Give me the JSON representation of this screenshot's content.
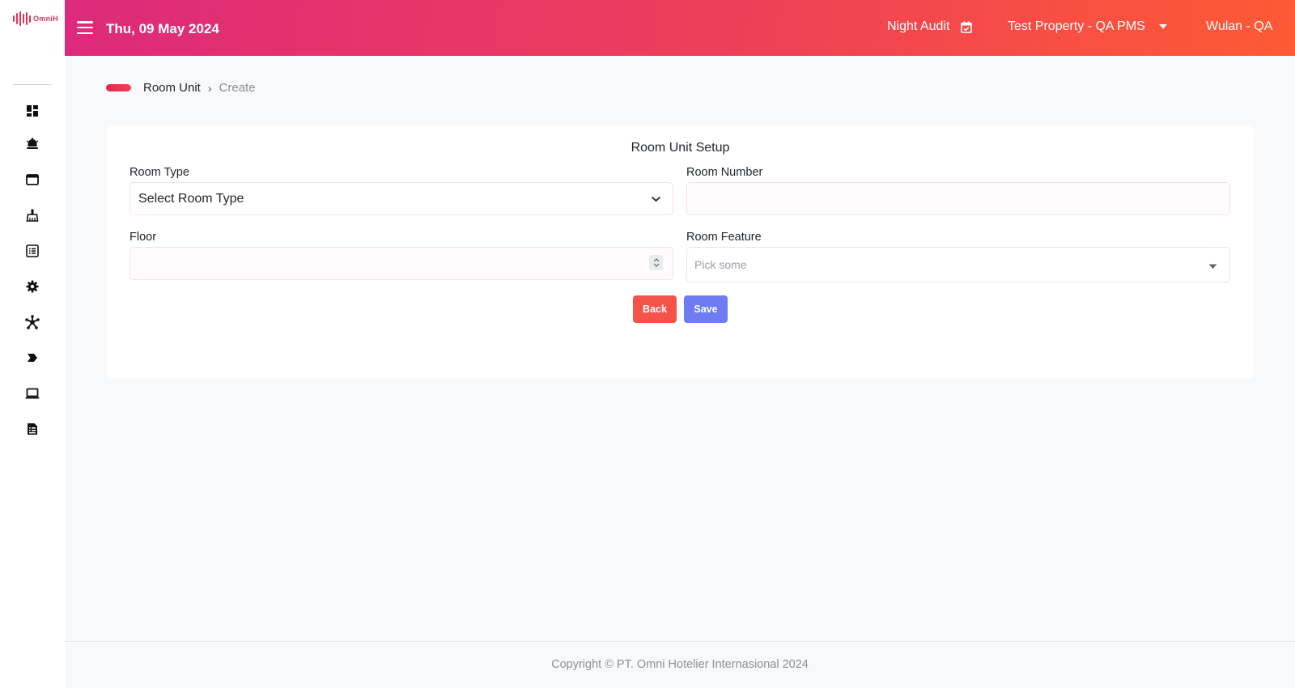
{
  "app": {
    "logo_text": "OmniH"
  },
  "header": {
    "date": "Thu, 09 May 2024",
    "night_audit_label": "Night Audit",
    "property_label": "Test Property - QA PMS",
    "user_label": "Wulan - QA",
    "background_gradient": [
      "#dd2a7b",
      "#ef3f58",
      "#fe5a34"
    ]
  },
  "sidebar": {
    "items": [
      {
        "icon": "dashboard-icon"
      },
      {
        "icon": "concierge-bell-icon"
      },
      {
        "icon": "window-icon"
      },
      {
        "icon": "broom-icon"
      },
      {
        "icon": "list-icon"
      },
      {
        "icon": "gear-icon"
      },
      {
        "icon": "network-icon"
      },
      {
        "icon": "chevron-tag-icon"
      },
      {
        "icon": "laptop-icon"
      },
      {
        "icon": "report-icon"
      }
    ]
  },
  "breadcrumb": {
    "parent": "Room Unit",
    "separator": "›",
    "current": "Create"
  },
  "form": {
    "title": "Room Unit Setup",
    "room_type": {
      "label": "Room Type",
      "value": "Select Room Type"
    },
    "room_number": {
      "label": "Room Number",
      "value": ""
    },
    "floor": {
      "label": "Floor",
      "value": ""
    },
    "room_feature": {
      "label": "Room Feature",
      "placeholder": "Pick some"
    },
    "back_label": "Back",
    "save_label": "Save"
  },
  "colors": {
    "accent": "#ef3f58",
    "back_button": "#f5524a",
    "save_button": "#6e7bf2"
  },
  "footer": {
    "copyright": "Copyright © PT. Omni Hotelier Internasional 2024"
  }
}
